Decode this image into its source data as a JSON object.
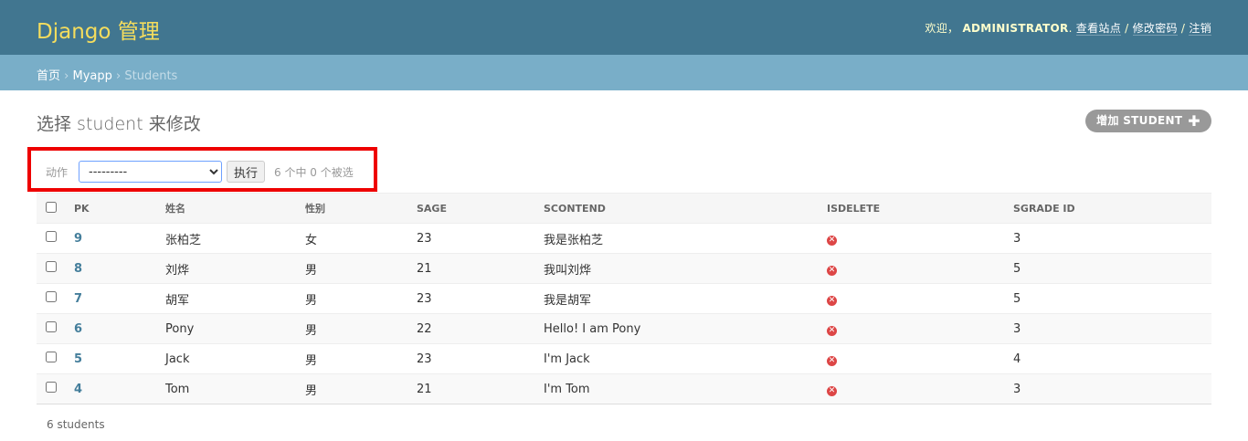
{
  "header": {
    "brand": "Django 管理",
    "welcome": "欢迎，",
    "username": "ADMINISTRATOR",
    "view_site": "查看站点",
    "change_password": "修改密码",
    "logout": "注销",
    "sep": "/"
  },
  "breadcrumbs": {
    "home": "首页",
    "app": "Myapp",
    "current": "Students",
    "sep": "›"
  },
  "page_title": "选择 student 来修改",
  "add_button": {
    "label": "增加 STUDENT",
    "icon": "plus-icon"
  },
  "actions": {
    "label": "动作",
    "selected": "---------",
    "go_label": "执行",
    "counter": "6 个中 0 个被选"
  },
  "table": {
    "columns": [
      "PK",
      "姓名",
      "性别",
      "SAGE",
      "SCONTEND",
      "ISDELETE",
      "SGRADE ID"
    ],
    "rows": [
      {
        "pk": "9",
        "name": "张柏芝",
        "sex": "女",
        "age": "23",
        "content": "我是张柏芝",
        "isdelete": "false",
        "grade": "3"
      },
      {
        "pk": "8",
        "name": "刘烨",
        "sex": "男",
        "age": "21",
        "content": "我叫刘烨",
        "isdelete": "false",
        "grade": "5"
      },
      {
        "pk": "7",
        "name": "胡军",
        "sex": "男",
        "age": "23",
        "content": "我是胡军",
        "isdelete": "false",
        "grade": "5"
      },
      {
        "pk": "6",
        "name": "Pony",
        "sex": "男",
        "age": "22",
        "content": "Hello! I am Pony",
        "isdelete": "false",
        "grade": "3"
      },
      {
        "pk": "5",
        "name": "Jack",
        "sex": "男",
        "age": "23",
        "content": "I'm Jack",
        "isdelete": "false",
        "grade": "4"
      },
      {
        "pk": "4",
        "name": "Tom",
        "sex": "男",
        "age": "21",
        "content": "I'm Tom",
        "isdelete": "false",
        "grade": "3"
      }
    ]
  },
  "paginator": "6 students",
  "colors": {
    "header": "#417690",
    "brand": "#f5dd5d",
    "breadcrumbs": "#79aec8",
    "highlight": "#ee0000"
  }
}
